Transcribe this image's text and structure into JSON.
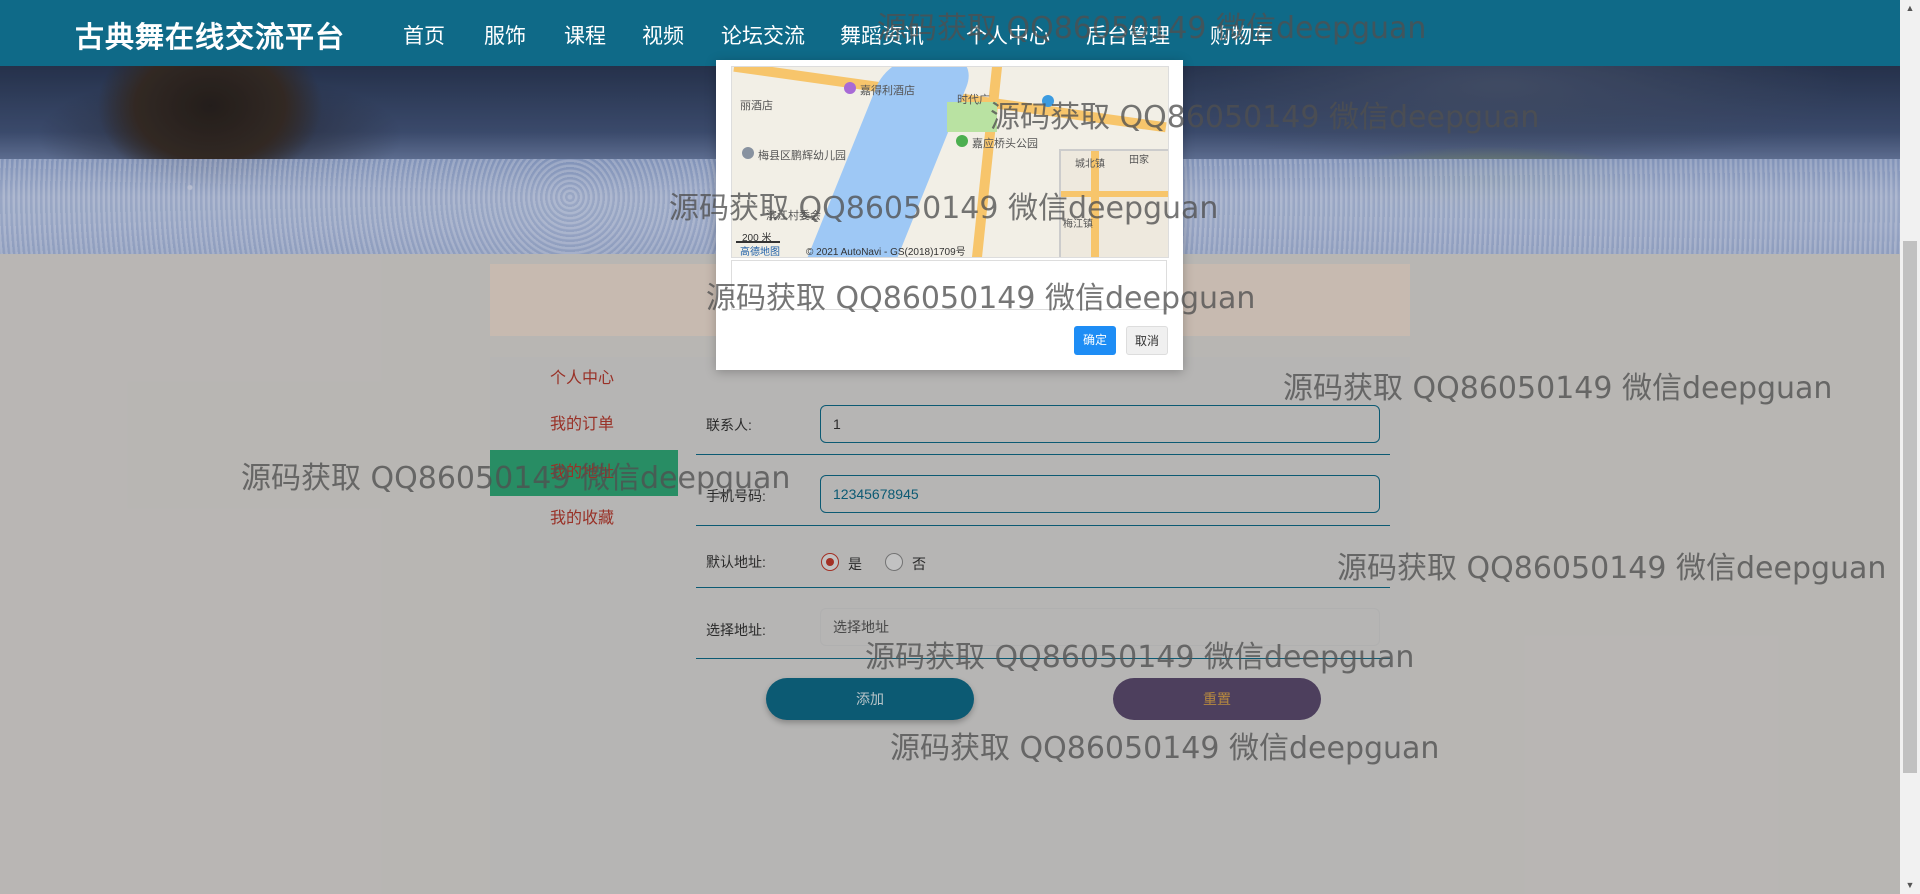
{
  "header": {
    "brand": "古典舞在线交流平台",
    "nav": [
      {
        "label": "首页"
      },
      {
        "label": "服饰"
      },
      {
        "label": "课程"
      },
      {
        "label": "视频"
      },
      {
        "label": "论坛交流"
      },
      {
        "label": "舞蹈资讯"
      },
      {
        "label": "个人中心"
      },
      {
        "label": "后台管理"
      },
      {
        "label": "购物车"
      }
    ],
    "active": "个人中心"
  },
  "sidebar": {
    "items": [
      {
        "label": "个人中心"
      },
      {
        "label": "我的订单"
      },
      {
        "label": "我的地址"
      },
      {
        "label": "我的收藏"
      }
    ]
  },
  "form": {
    "contact_label": "联系人:",
    "contact_value": "1",
    "phone_label": "手机号码:",
    "phone_value": "12345678945",
    "default_label": "默认地址:",
    "default_yes": "是",
    "default_no": "否",
    "default_selected": "是",
    "address_label": "选择地址:",
    "address_placeholder": "选择地址",
    "add_button": "添加",
    "reset_button": "重置"
  },
  "modal": {
    "map_labels": {
      "poi1": "嘉得利酒店",
      "poi2": "时代广",
      "poi3": "梅县区鹏辉幼儿园",
      "poi4": "嘉应桥头公园",
      "poi5": "丽酒店",
      "poi6": "城北镇",
      "poi7": "梅江镇",
      "poi8": "田家",
      "poi9": "滨江村委会",
      "scale": "200 米",
      "logo": "高德地图",
      "copyright": "© 2021 AutoNavi - GS(2018)1709号"
    },
    "ok_button": "确定",
    "cancel_button": "取消"
  },
  "watermark": "源码获取 QQ86050149 微信deepguan",
  "colors": {
    "nav_bg": "#0f6a88",
    "active_side": "#2fa676",
    "add_btn": "#0f6a88",
    "reset_btn": "#5b4b6e",
    "ok_btn": "#1e8df5"
  }
}
